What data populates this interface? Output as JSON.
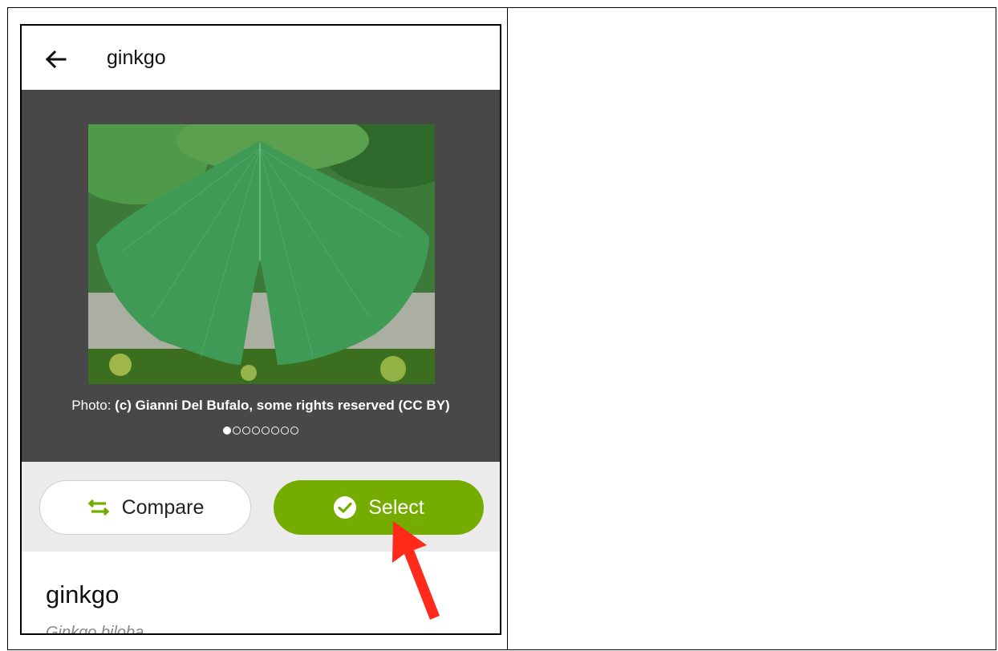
{
  "app_bar": {
    "title": "ginkgo",
    "back_icon": "arrow-left-icon"
  },
  "gallery": {
    "photo_subject": "ginkgo leaf",
    "credit_prefix": "Photo: ",
    "credit_text": "(c) Gianni Del Bufalo, some rights reserved (CC BY)",
    "page_count": 8,
    "active_page": 1
  },
  "actions": {
    "compare_label": "Compare",
    "compare_icon": "swap-arrows-icon",
    "select_label": "Select",
    "select_icon": "check-circle-icon"
  },
  "details": {
    "common_name": "ginkgo",
    "scientific_name": "Ginkgo biloba"
  },
  "colors": {
    "accent": "#74ac00",
    "gallery_bg": "#484848",
    "actions_bg": "#ebebeb",
    "annotation_arrow": "#ff2a1a"
  }
}
